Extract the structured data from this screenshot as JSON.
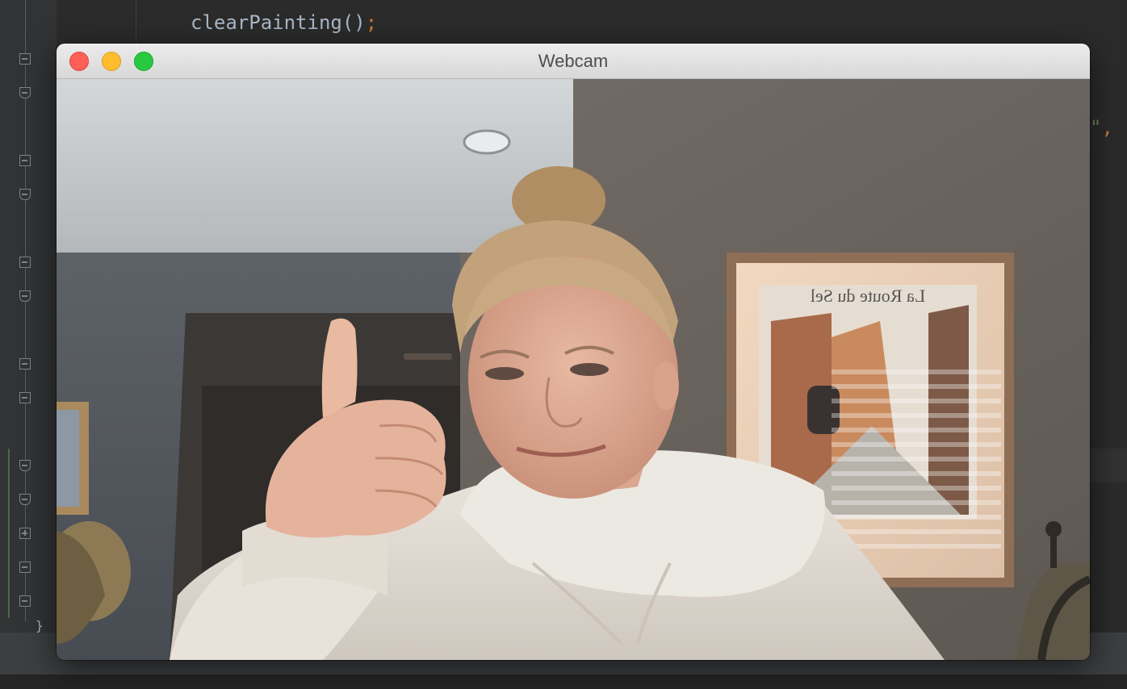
{
  "editor": {
    "code_line": "clearPainting()",
    "code_line_semicolon": ";",
    "partial_top_line": "",
    "right_edge_string": "\"",
    "right_edge_comma": ",",
    "closing_brace": "}",
    "colors": {
      "background": "#2b2b2b",
      "gutter": "#313335",
      "identifier": "#a9b7c6",
      "keyword_punct": "#cc7832",
      "string": "#6a8759"
    },
    "gutter_markers": [
      {
        "icon": "fold-minus-icon"
      },
      {
        "icon": "fold-end-icon"
      },
      {
        "icon": "fold-minus-icon"
      },
      {
        "icon": "fold-end-icon"
      },
      {
        "icon": "fold-minus-icon"
      },
      {
        "icon": "fold-end-icon"
      },
      {
        "icon": "fold-minus-icon"
      },
      {
        "icon": "fold-minus-icon"
      },
      {
        "icon": "fold-end-icon"
      },
      {
        "icon": "fold-end-icon"
      },
      {
        "icon": "fold-plus-icon"
      },
      {
        "icon": "fold-minus-icon"
      },
      {
        "icon": "fold-minus-icon"
      }
    ]
  },
  "window": {
    "title": "Webcam",
    "buttons": {
      "close": {
        "icon": "close-icon",
        "color": "#fe5f57"
      },
      "minimize": {
        "icon": "minimize-icon",
        "color": "#febc2e"
      },
      "zoom": {
        "icon": "zoom-icon",
        "color": "#28c840"
      }
    },
    "video": {
      "poster_text_mirrored": "La Route du Sel"
    }
  }
}
